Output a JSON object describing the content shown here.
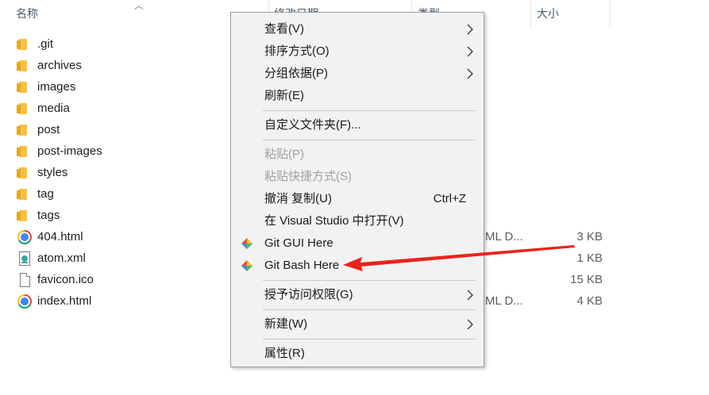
{
  "header": {
    "name_label": "名称",
    "modified_label": "修改日期",
    "type_label": "类型",
    "size_label": "大小"
  },
  "files": [
    {
      "name": ".git",
      "icon": "folder-icon",
      "type": "",
      "size": ""
    },
    {
      "name": "archives",
      "icon": "folder-icon",
      "type": "",
      "size": ""
    },
    {
      "name": "images",
      "icon": "folder-icon",
      "type": "",
      "size": ""
    },
    {
      "name": "media",
      "icon": "folder-icon",
      "type": "",
      "size": ""
    },
    {
      "name": "post",
      "icon": "folder-icon",
      "type": "",
      "size": ""
    },
    {
      "name": "post-images",
      "icon": "folder-icon",
      "type": "",
      "size": ""
    },
    {
      "name": "styles",
      "icon": "folder-icon",
      "type": "",
      "size": ""
    },
    {
      "name": "tag",
      "icon": "folder-icon",
      "type": "",
      "size": ""
    },
    {
      "name": "tags",
      "icon": "folder-icon",
      "type": "",
      "size": ""
    },
    {
      "name": "404.html",
      "icon": "chrome-icon",
      "type": "ML D...",
      "size": "3 KB"
    },
    {
      "name": "atom.xml",
      "icon": "xml-file-icon",
      "type": "",
      "size": "1 KB"
    },
    {
      "name": "favicon.ico",
      "icon": "file-icon",
      "type": "",
      "size": "15 KB"
    },
    {
      "name": "index.html",
      "icon": "chrome-icon",
      "type": "ML D...",
      "size": "4 KB"
    }
  ],
  "context_menu": {
    "view": "查看(V)",
    "sort_by": "排序方式(O)",
    "group_by": "分组依据(P)",
    "refresh": "刷新(E)",
    "customize_folder": "自定义文件夹(F)...",
    "paste": "粘贴(P)",
    "paste_shortcut": "粘贴快捷方式(S)",
    "undo_copy": "撤消 复制(U)",
    "undo_shortcut": "Ctrl+Z",
    "open_in_vs": "在 Visual Studio 中打开(V)",
    "git_gui": "Git GUI Here",
    "git_bash": "Git Bash Here",
    "grant_access": "授予访问权限(G)",
    "new": "新建(W)",
    "properties": "属性(R)"
  },
  "colors": {
    "menu_bg": "#f2f2f2",
    "disabled_text": "#a0a0a0",
    "annotation_arrow": "#e8241b",
    "folder": "#f3c144"
  }
}
